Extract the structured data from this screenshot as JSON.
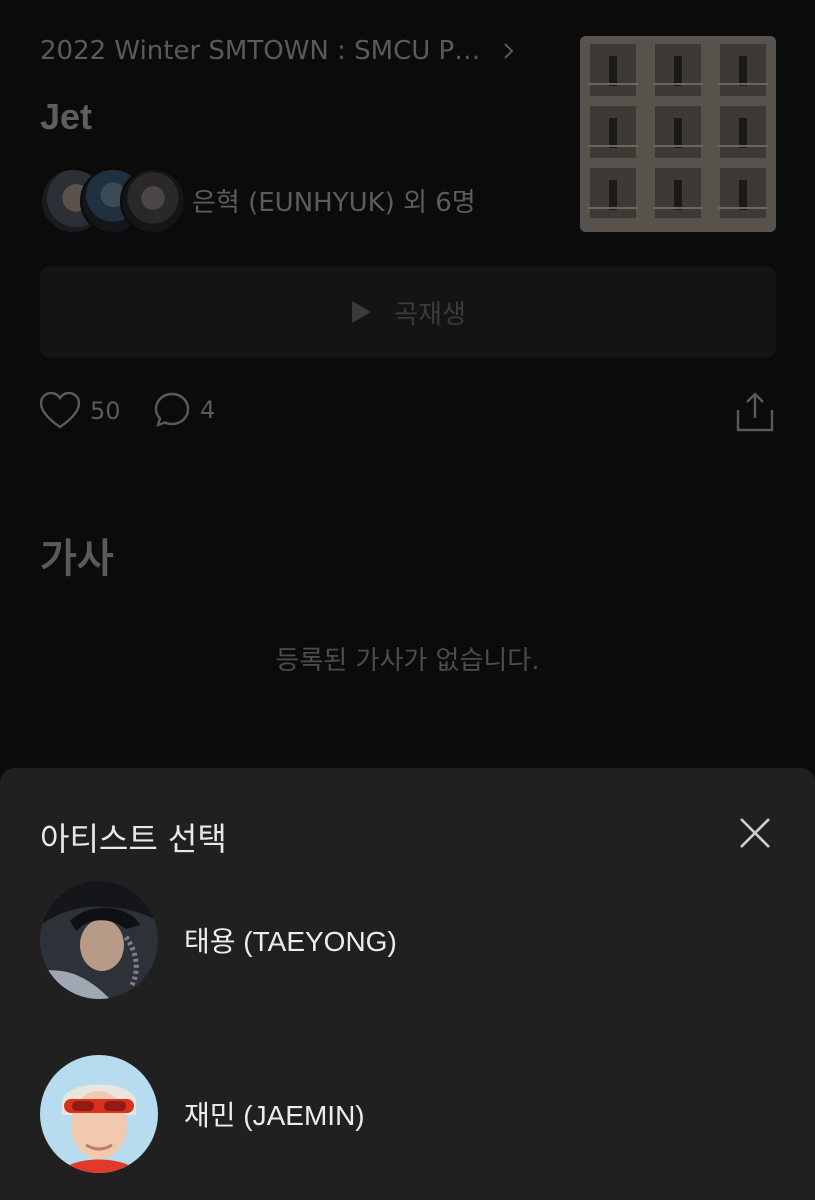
{
  "album": {
    "title": "2022 Winter SMTOWN : SMCU P…"
  },
  "song": {
    "title": "Jet"
  },
  "artists": {
    "label": "은혁 (EUNHYUK) 외 6명"
  },
  "player": {
    "play_label": "곡재생"
  },
  "actions": {
    "likes": "50",
    "comments": "4"
  },
  "lyrics": {
    "section_title": "가사",
    "empty_message": "등록된 가사가 없습니다."
  },
  "artist_sheet": {
    "title": "아티스트 선택",
    "items": [
      {
        "name": "태용 (TAEYONG)"
      },
      {
        "name": "재민 (JAEMIN)"
      }
    ]
  },
  "icons": {
    "album_chevron": "chevron-right-icon",
    "play": "play-icon",
    "like": "heart-icon",
    "comment": "comment-icon",
    "share": "share-icon",
    "close": "close-icon"
  },
  "colors": {
    "background": "#0b0b0b",
    "sheet_background": "#202020",
    "dim_text": "#5c5c5c",
    "sheet_text": "#ededed"
  }
}
